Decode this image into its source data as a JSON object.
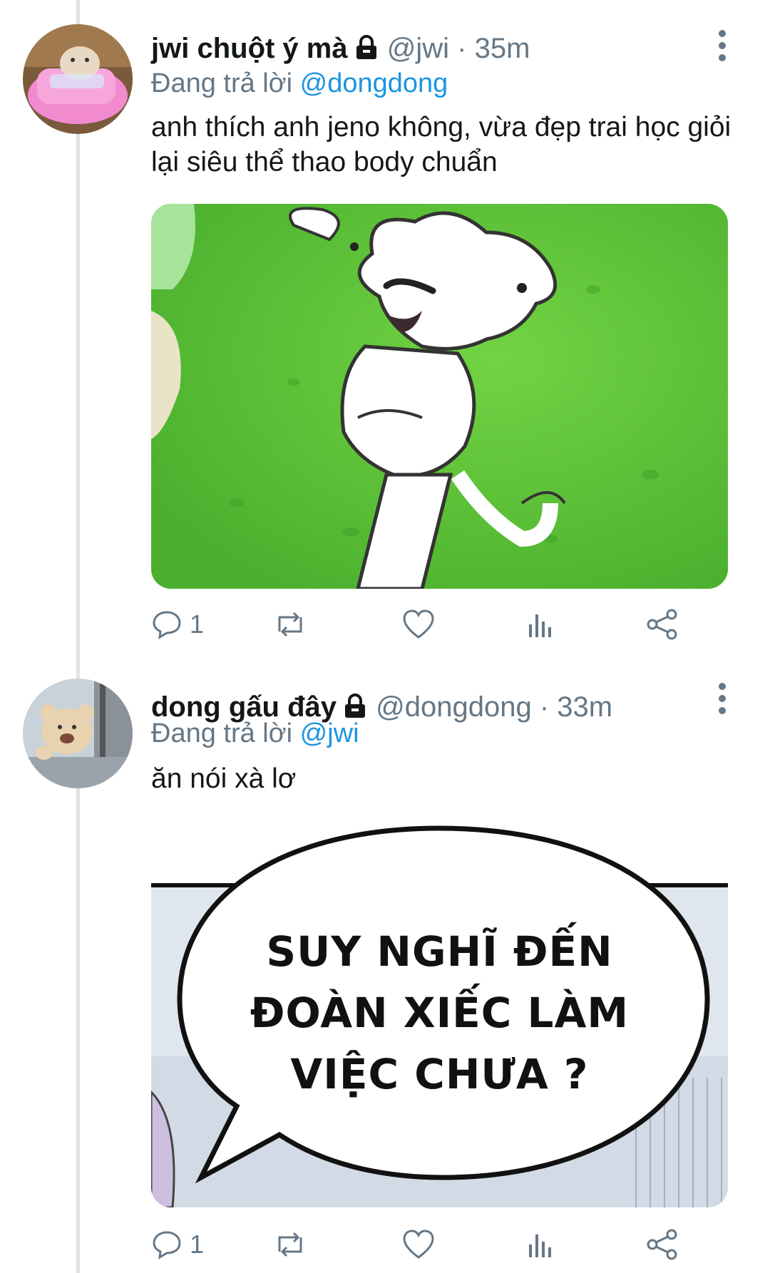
{
  "tweets": [
    {
      "name": "jwi chuột ý mà",
      "handle": "@jwi",
      "separator": "·",
      "time": "35m",
      "replying_prefix": "Đang trả lời",
      "replying_to": "@dongdong",
      "text": "anh thích anh jeno không, vừa đẹp trai học giỏi lại siêu thể thao body chuẩn",
      "media": "cartoon-white-dog-flexing-image",
      "actions": {
        "reply_count": "1",
        "retweet_count": "",
        "like_count": ""
      }
    },
    {
      "name": "dong gấu đây",
      "handle": "@dongdong",
      "separator": "·",
      "time": "33m",
      "replying_prefix": "Đang trả lời",
      "replying_to": "@jwi",
      "text": "ăn nói xà lơ",
      "media_caption": [
        "SUY NGHĨ ĐẾN",
        "ĐOÀN XIẾC LÀM",
        "VIỆC CHƯA ?"
      ],
      "actions": {
        "reply_count": "1",
        "retweet_count": "",
        "like_count": ""
      }
    }
  ],
  "colors": {
    "link": "#1b95e0",
    "secondary": "#657786",
    "thread_line": "#dfe3e6",
    "meme_green": "#5fc43a"
  },
  "icons": [
    "lock-icon",
    "more-icon",
    "reply-icon",
    "retweet-icon",
    "like-icon",
    "analytics-icon",
    "share-icon"
  ]
}
